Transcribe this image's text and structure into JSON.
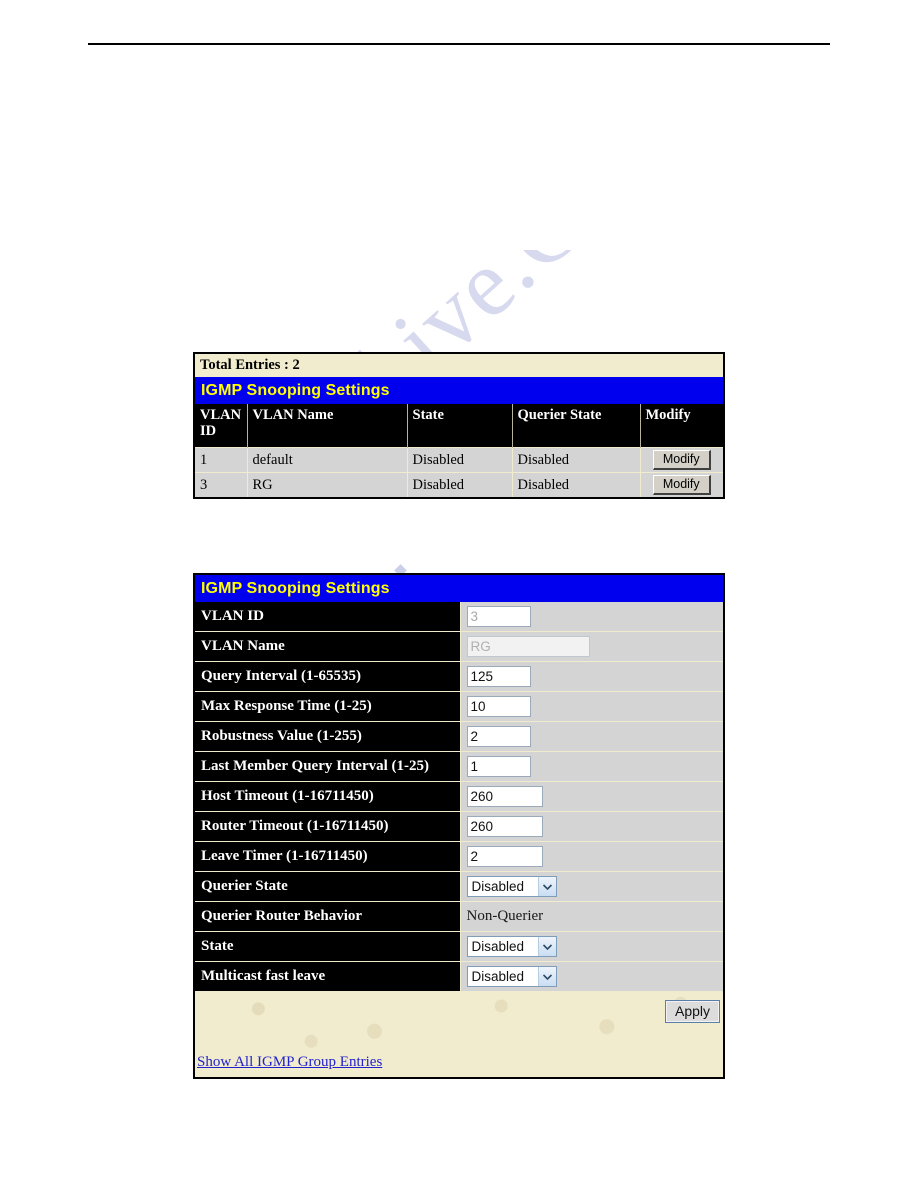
{
  "list_panel": {
    "total_entries_label": "Total Entries : 2",
    "title": "IGMP Snooping Settings",
    "columns": [
      "VLAN ID",
      "VLAN Name",
      "State",
      "Querier State",
      "Modify"
    ],
    "rows": [
      {
        "vlan_id": "1",
        "vlan_name": "default",
        "state": "Disabled",
        "querier_state": "Disabled",
        "modify_label": "Modify"
      },
      {
        "vlan_id": "3",
        "vlan_name": "RG",
        "state": "Disabled",
        "querier_state": "Disabled",
        "modify_label": "Modify"
      }
    ]
  },
  "form_panel": {
    "title": "IGMP Snooping Settings",
    "fields": [
      {
        "label": "VLAN ID",
        "value": "3"
      },
      {
        "label": "VLAN Name",
        "value": "RG"
      },
      {
        "label": "Query Interval (1-65535)",
        "value": "125"
      },
      {
        "label": "Max Response Time (1-25)",
        "value": "10"
      },
      {
        "label": "Robustness Value (1-255)",
        "value": "2"
      },
      {
        "label": "Last Member Query Interval (1-25)",
        "value": "1"
      },
      {
        "label": "Host Timeout (1-16711450)",
        "value": "260"
      },
      {
        "label": "Router Timeout (1-16711450)",
        "value": "260"
      },
      {
        "label": "Leave Timer (1-16711450)",
        "value": "2"
      },
      {
        "label": "Querier State",
        "value": "Disabled"
      },
      {
        "label": "Querier Router Behavior",
        "value": "Non-Querier"
      },
      {
        "label": "State",
        "value": "Disabled"
      },
      {
        "label": "Multicast fast leave",
        "value": "Disabled"
      }
    ],
    "apply_label": "Apply",
    "show_all_link": "Show All IGMP Group Entries"
  },
  "watermark": {
    "text": "Archive.Com"
  },
  "colors": {
    "title_bar_bg": "#0000ee",
    "title_bar_text": "#ffff00",
    "label_bg": "#000000",
    "label_text": "#ffffff",
    "cell_bg": "#d4d4d4",
    "cream": "#f2eccf",
    "link": "#2222cc"
  }
}
